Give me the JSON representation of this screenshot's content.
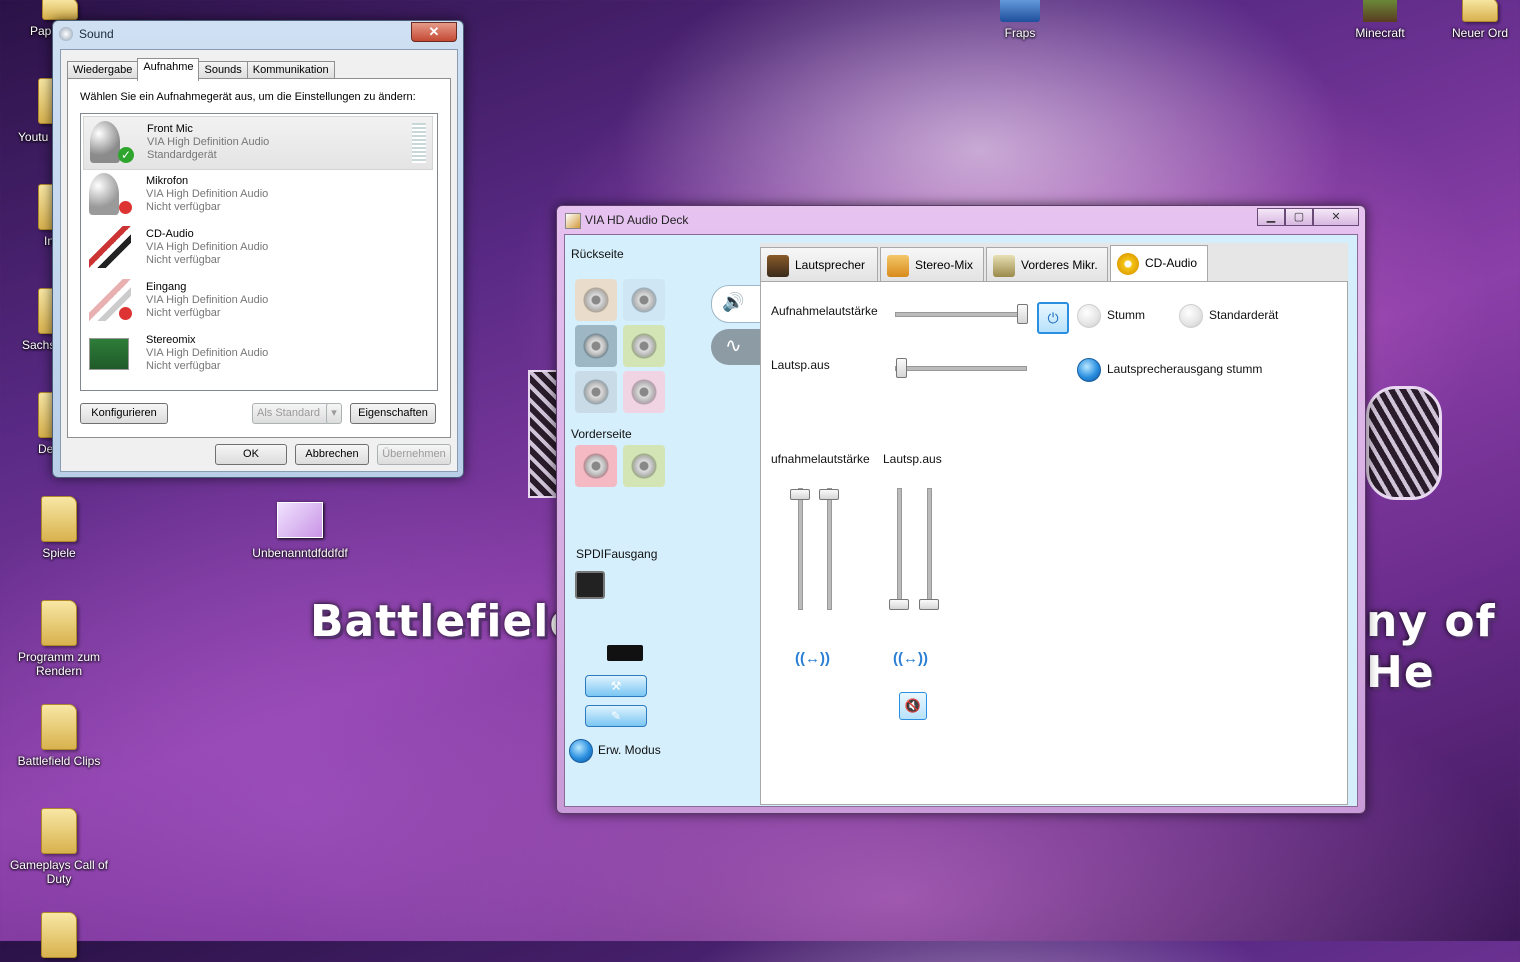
{
  "desktop": {
    "icons": [
      {
        "label": "Pap"
      },
      {
        "label": "Youtu"
      },
      {
        "label": "In"
      },
      {
        "label": "Sachs"
      },
      {
        "label": "De"
      },
      {
        "label": "Spiele"
      },
      {
        "label": "Programm zum Rendern"
      },
      {
        "label": "Battlefield Clips"
      },
      {
        "label": "Gameplays Call of Duty"
      },
      {
        "label": "Fraps"
      },
      {
        "label": "Minecraft"
      },
      {
        "label": "Neuer Ord"
      },
      {
        "label": "Unbenanntdfddfdf"
      }
    ],
    "wallpaper_text_left": "Battlefield",
    "wallpaper_text_right": "ny of He"
  },
  "sound_dialog": {
    "title": "Sound",
    "close_label": "✕",
    "tabs": [
      "Wiedergabe",
      "Aufnahme",
      "Sounds",
      "Kommunikation"
    ],
    "active_tab": "Aufnahme",
    "instruction": "Wählen Sie ein Aufnahmegerät aus, um die Einstellungen zu ändern:",
    "devices": [
      {
        "name": "Front Mic",
        "driver": "VIA High Definition Audio",
        "status": "Standardgerät",
        "icon": "microphone-icon"
      },
      {
        "name": "Mikrofon",
        "driver": "VIA High Definition Audio",
        "status": "Nicht verfügbar",
        "icon": "microphone-icon"
      },
      {
        "name": "CD-Audio",
        "driver": "VIA High Definition Audio",
        "status": "Nicht verfügbar",
        "icon": "cable-icon"
      },
      {
        "name": "Eingang",
        "driver": "VIA High Definition Audio",
        "status": "Nicht verfügbar",
        "icon": "cable-icon"
      },
      {
        "name": "Stereomix",
        "driver": "VIA High Definition Audio",
        "status": "Nicht verfügbar",
        "icon": "soundcard-icon"
      }
    ],
    "configure_label": "Konfigurieren",
    "set_default_label": "Als Standard",
    "properties_label": "Eigenschaften",
    "ok_label": "OK",
    "cancel_label": "Abbrechen",
    "apply_label": "Übernehmen"
  },
  "via_deck": {
    "title": "VIA HD Audio Deck",
    "left": {
      "rear_label": "Rückseite",
      "front_label": "Vorderseite",
      "spdif_label": "SPDIFausgang",
      "advanced_mode_label": "Erw. Modus",
      "rear_jack_colors": [
        "#e9dccb",
        "#cfe6f5",
        "#9db7c5",
        "#d3e4b5",
        "#c9dbe6",
        "#f0d4e4"
      ],
      "front_jack_colors": [
        "#f4b9c3",
        "#d3e4b5"
      ]
    },
    "tabs": [
      "Lautsprecher",
      "Stereo-Mix",
      "Vorderes Mikr.",
      "CD-Audio"
    ],
    "active_tab": "CD-Audio",
    "panel": {
      "recording_volume_label": "Aufnahmelautstärke",
      "mute_label": "Stumm",
      "default_device_label": "Standarderät",
      "speaker_out_label": "Lautsp.aus",
      "speaker_out_mute_label": "Lautsprecherausgang stumm",
      "recording_volume_level": 0.95,
      "speaker_out_level": 0.02,
      "mixer_left_label": "ufnahmelautstärke",
      "mixer_right_label": "Lautsp.aus",
      "balance_symbol": "((↔))"
    }
  }
}
